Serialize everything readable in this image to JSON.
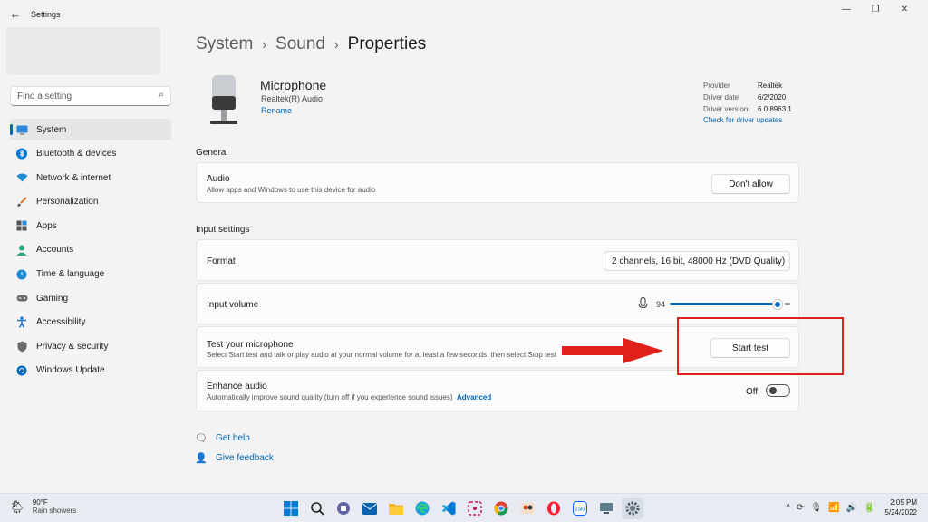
{
  "window": {
    "title": "Settings",
    "controls": [
      "—",
      "❐",
      "✕"
    ]
  },
  "sidebar": {
    "search_placeholder": "Find a setting",
    "items": [
      {
        "label": "System",
        "icon": "monitor-icon",
        "color": "#0067c0",
        "active": true
      },
      {
        "label": "Bluetooth & devices",
        "icon": "bluetooth-icon",
        "color": "#0078d4"
      },
      {
        "label": "Network & internet",
        "icon": "wifi-icon",
        "color": "#1a8ad4"
      },
      {
        "label": "Personalization",
        "icon": "brush-icon",
        "color": "#d97a2a"
      },
      {
        "label": "Apps",
        "icon": "apps-icon",
        "color": "#555555"
      },
      {
        "label": "Accounts",
        "icon": "person-icon",
        "color": "#2aa57a"
      },
      {
        "label": "Time & language",
        "icon": "globe-clock-icon",
        "color": "#1a8ad4"
      },
      {
        "label": "Gaming",
        "icon": "controller-icon",
        "color": "#6b6b6b"
      },
      {
        "label": "Accessibility",
        "icon": "accessibility-icon",
        "color": "#1a6fd4"
      },
      {
        "label": "Privacy & security",
        "icon": "shield-icon",
        "color": "#6b6b6b"
      },
      {
        "label": "Windows Update",
        "icon": "update-icon",
        "color": "#0067c0"
      }
    ]
  },
  "breadcrumb": {
    "items": [
      "System",
      "Sound"
    ],
    "separator": "›",
    "current": "Properties"
  },
  "device": {
    "name": "Microphone",
    "driver_name": "Realtek(R) Audio",
    "rename_label": "Rename",
    "provider_label": "Provider",
    "provider": "Realtek",
    "driver_date_label": "Driver date",
    "driver_date": "6/2/2020",
    "driver_version_label": "Driver version",
    "driver_version": "6.0.8963.1",
    "check_updates_label": "Check for driver updates"
  },
  "general": {
    "title": "General",
    "audio_label": "Audio",
    "audio_desc": "Allow apps and Windows to use this device for audio",
    "audio_button": "Don't allow"
  },
  "input_settings": {
    "title": "Input settings",
    "format_label": "Format",
    "format_value": "2 channels, 16 bit, 48000 Hz (DVD Quality)",
    "volume_label": "Input volume",
    "volume_value": "94",
    "volume_level": 0.94,
    "test_label": "Test your microphone",
    "test_desc": "Select Start test and talk or play audio at your normal volume for at least a few seconds, then select Stop test",
    "test_button": "Start test",
    "enhance_label": "Enhance audio",
    "enhance_desc": "Automatically improve sound quality (turn off if you experience sound issues)",
    "enhance_advanced": "Advanced",
    "enhance_state": "Off"
  },
  "help": {
    "get_help": "Get help",
    "give_feedback": "Give feedback"
  },
  "taskbar": {
    "weather_temp": "90°F",
    "weather_desc": "Rain showers",
    "time": "2:05 PM",
    "date": "5/24/2022"
  },
  "colors": {
    "accent": "#0067c0",
    "annotation": "#e0201b",
    "link": "#0063b1"
  }
}
